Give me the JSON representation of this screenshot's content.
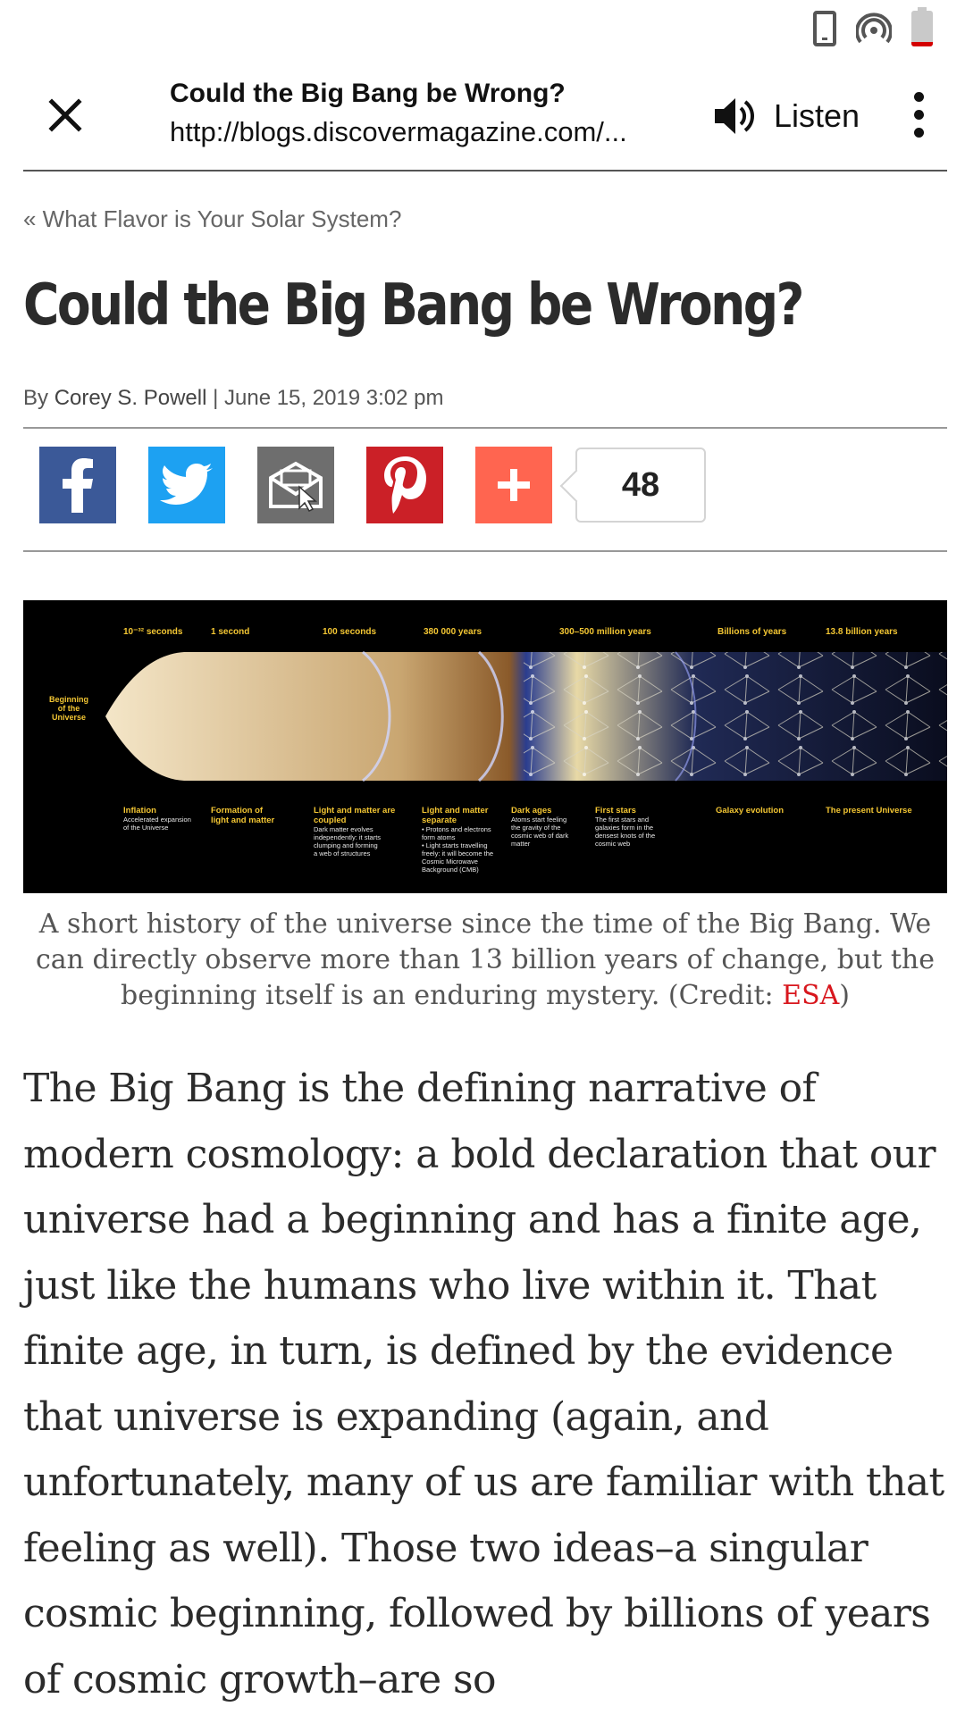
{
  "toolbar": {
    "title": "Could the Big Bang be Wrong?",
    "url": "http://blogs.discovermagazine.com/...",
    "listen_label": "Listen"
  },
  "article": {
    "prev_link": "« What Flavor is Your Solar System?",
    "headline": "Could the Big Bang be Wrong?",
    "byline_prefix": "By ",
    "author": "Corey S. Powell",
    "date": " | June 15, 2019 3:02 pm",
    "share_count": "48",
    "share_buttons": [
      "facebook-icon",
      "twitter-icon",
      "email-icon",
      "pinterest-icon",
      "plus-icon"
    ],
    "colors": {
      "facebook": "#3b5998",
      "twitter": "#1da1f2",
      "email": "#6e6e6e",
      "pinterest": "#cb2027",
      "plus": "#ff6550",
      "link_red": "#d8161d"
    }
  },
  "figure": {
    "beginning_label": "Beginning of the Universe",
    "timeline_top": [
      "10⁻³² seconds",
      "1 second",
      "100 seconds",
      "380 000 years",
      "300–500 million years",
      "Billions of years",
      "13.8 billion years"
    ],
    "stages": [
      {
        "title": "Inflation",
        "desc": "Accelerated expansion\nof the Universe"
      },
      {
        "title": "Formation of light and matter",
        "desc": ""
      },
      {
        "title": "Light and matter are coupled",
        "desc": "Dark matter evolves\nindependently: it starts\nclumping and forming\na web of structures"
      },
      {
        "title": "Light and matter separate",
        "desc": "• Protons and electrons\nform atoms\n• Light starts travelling\nfreely: it will become the\nCosmic Microwave\nBackground (CMB)"
      },
      {
        "title": "Dark ages",
        "desc": "Atoms start feeling\nthe gravity of the\ncosmic web of dark\nmatter"
      },
      {
        "title": "First stars",
        "desc": "The first stars and\ngalaxies form in the\ndensest knots of the\ncosmic web"
      },
      {
        "title": "Galaxy evolution",
        "desc": ""
      },
      {
        "title": "The present Universe",
        "desc": ""
      }
    ]
  },
  "caption": {
    "text": "A short history of the universe since the time of the Big Bang. We can directly observe more than 13 billion years of change, but the beginning itself is an enduring mystery. (Credit: ",
    "credit": "ESA",
    "close": ")"
  },
  "body": {
    "paragraph": "The Big Bang is the defining narrative of modern cosmology: a bold declaration that our universe had a beginning and has a finite age, just like the humans who live within it. That finite age, in turn, is defined by the evidence that universe is expanding (again, and unfortunately, many of us are familiar with that feeling as well). Those two ideas–a singular cosmic beginning, followed by billions of years of cosmic growth–are so"
  }
}
